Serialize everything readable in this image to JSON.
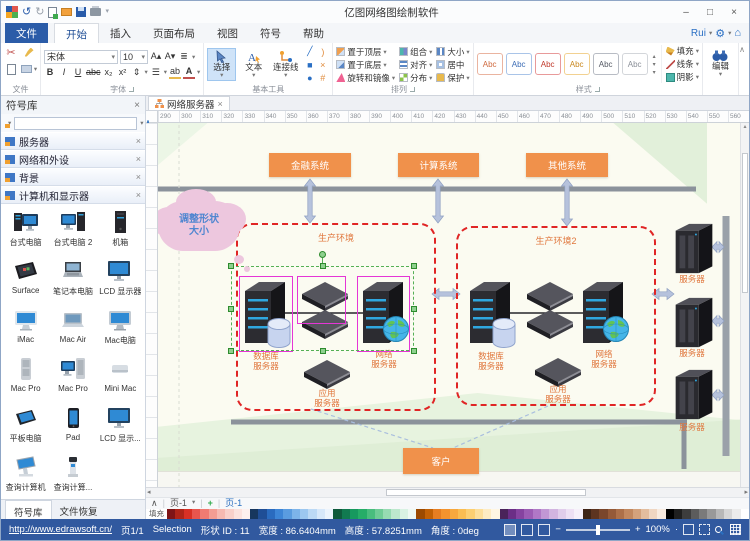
{
  "window": {
    "title": "亿图网络图绘制软件",
    "controls": {
      "minimize": "–",
      "maximize": "□",
      "close": "×"
    }
  },
  "glyphs": {
    "dropdown": "▾",
    "close": "×",
    "collapse": "∧",
    "undo": "↺",
    "redo": "↻",
    "left": "◂",
    "right": "▸",
    "up": "▴",
    "down": "▾",
    "minus": "−",
    "plus": "+",
    "sep": "|",
    "gear": "⚙",
    "home": "⌂",
    "dot": "·"
  },
  "tabs": {
    "file": "文件",
    "items": [
      "开始",
      "插入",
      "页面布局",
      "视图",
      "符号",
      "帮助"
    ],
    "active": "开始",
    "account": "Rui"
  },
  "ribbon": {
    "file_group": {
      "label": "文件"
    },
    "font_group": {
      "label": "字体",
      "font_name": "宋体",
      "font_size": "10",
      "b": "B",
      "i": "I",
      "u": "U",
      "strike": "abc",
      "sub": "x₂",
      "sup": "x²",
      "grow": "A",
      "shrink": "A",
      "align": "≣",
      "spacing": "⇕",
      "list": "☰",
      "highlight": "ab",
      "color": "A"
    },
    "basic_group": {
      "label": "基本工具",
      "select": "选择",
      "text": "文本",
      "connector": "连接线",
      "tools": [
        "╱",
        ")",
        "■",
        "×",
        "●",
        "#"
      ]
    },
    "arrange_group": {
      "label": "排列",
      "items": [
        "置于顶层",
        "置于底层",
        "旋转和镜像",
        "组合",
        "对齐",
        "分布",
        "大小",
        "居中",
        "保护"
      ]
    },
    "style_group": {
      "label": "样式",
      "preset_label": "Abc",
      "presets": [
        {
          "border": "#eab4a0",
          "color": "#cf6a3f"
        },
        {
          "border": "#a9c4e8",
          "color": "#3d6db5"
        },
        {
          "border": "#e89a9a",
          "color": "#c0392b"
        },
        {
          "border": "#f2d191",
          "color": "#c9881f"
        },
        {
          "border": "#b8bcc4",
          "color": "#555a64"
        },
        {
          "border": "#d3d6da",
          "color": "#8a8f98"
        }
      ],
      "fill": "填充",
      "line": "线条",
      "shadow": "阴影"
    },
    "edit_group": {
      "label": "编辑"
    }
  },
  "sidebar": {
    "title": "符号库",
    "search_placeholder": "",
    "sections": [
      "服务器",
      "网络和外设",
      "背景",
      "计算机和显示器"
    ],
    "symbols": [
      {
        "name": "台式电脑",
        "kind": "desktop"
      },
      {
        "name": "台式电脑 2",
        "kind": "desktop2"
      },
      {
        "name": "机箱",
        "kind": "case"
      },
      {
        "name": "Surface",
        "kind": "surface"
      },
      {
        "name": "笔记本电脑",
        "kind": "laptop"
      },
      {
        "name": "LCD 显示器",
        "kind": "monitor"
      },
      {
        "name": "iMac",
        "kind": "imac"
      },
      {
        "name": "Mac Air",
        "kind": "macair"
      },
      {
        "name": "Mac电脑",
        "kind": "macall"
      },
      {
        "name": "Mac Pro",
        "kind": "macpro"
      },
      {
        "name": "Mac Pro",
        "kind": "macpro2"
      },
      {
        "name": "Mini Mac",
        "kind": "minimac"
      },
      {
        "name": "平板电脑",
        "kind": "tablet"
      },
      {
        "name": "Pad",
        "kind": "pad"
      },
      {
        "name": "LCD 显示...",
        "kind": "monitor"
      },
      {
        "name": "查询计算机",
        "kind": "kiosk"
      },
      {
        "name": "查询计算...",
        "kind": "kiosk2"
      }
    ],
    "bottom_tabs": [
      "符号库",
      "文件恢复"
    ]
  },
  "canvas": {
    "doc_tab": "网络服务器",
    "ruler_numbers": [
      290,
      300,
      310,
      320,
      330,
      340,
      350,
      360,
      370,
      380,
      390,
      400,
      410,
      420,
      430,
      440,
      450,
      460,
      470,
      480,
      490,
      500,
      510,
      520,
      530,
      540,
      550,
      560
    ]
  },
  "diagram": {
    "top_boxes": [
      "金融系统",
      "计算系统",
      "其他系统"
    ],
    "env1_label": "生产环境",
    "env2_label": "生产环境2",
    "db_server": "数据库\n服务器",
    "net_server": "网络\n服务器",
    "app_server": "应用\n服务器",
    "right_servers": [
      "服务器",
      "服务器",
      "服务器"
    ],
    "client": "客户",
    "cloud_note": "调整形状\n大小"
  },
  "page_bar": {
    "nav_page": "页-1",
    "add": "+",
    "page_tab": "页-1"
  },
  "palette": {
    "fill_label": "填充",
    "colors": [
      "#7f1416",
      "#b02418",
      "#d93025",
      "#e8554e",
      "#ef7b72",
      "#f29d93",
      "#f5b9b1",
      "#f8d0ca",
      "#fbe2de",
      "#fdf0ee",
      "#17375e",
      "#1f4e96",
      "#2a6bbf",
      "#3d85d6",
      "#5a9ce0",
      "#7db4ea",
      "#9cc7f0",
      "#bcd9f5",
      "#d7e8fa",
      "#ecf4fd",
      "#0e5a3c",
      "#117a50",
      "#17995f",
      "#26ad68",
      "#49bd7e",
      "#6fcc96",
      "#96dbb2",
      "#bce8cd",
      "#d9f2e3",
      "#eff9f3",
      "#9c4a00",
      "#c26105",
      "#e67e22",
      "#f3932e",
      "#f7a83e",
      "#fabd52",
      "#fccf72",
      "#fddf9b",
      "#feecc3",
      "#fff6e3",
      "#4a235a",
      "#6b2e86",
      "#8643a0",
      "#9c5cb4",
      "#b078c6",
      "#c197d4",
      "#d2b4e0",
      "#e1cdeb",
      "#eee0f4",
      "#f7f0fa",
      "#3f2416",
      "#5d3420",
      "#7a462b",
      "#955a38",
      "#ad7049",
      "#c2885f",
      "#d4a27c",
      "#e3bd9e",
      "#efd6c2",
      "#f8ebe0",
      "#000000",
      "#1f1f1f",
      "#3d3d3d",
      "#5c5c5c",
      "#7a7a7a",
      "#999999",
      "#b8b8b8",
      "#d6d6d6",
      "#ebebeb",
      "#ffffff"
    ]
  },
  "status_bar": {
    "link": "http://www.edrawsoft.cn/",
    "page": "页1/1",
    "mode": "Selection",
    "shape_id": "形状 ID : 11",
    "width": "宽度 : 86.6404mm",
    "height": "高度 : 57.8251mm",
    "angle": "角度 : 0deg",
    "zoom": "100%"
  },
  "colors": {
    "accent_blue": "#2b5ca8",
    "status_bar": "#31599f",
    "shape_orange": "#f0914b",
    "env_dashed_red": "#e02525",
    "label_orange": "#e0763c",
    "selection_green": "#55b055",
    "highlight_magenta": "#e535d6",
    "bus_gray": "#8b929b",
    "arrow_blue": "#b6c2dc",
    "cloud_pink": "#edc7de"
  }
}
